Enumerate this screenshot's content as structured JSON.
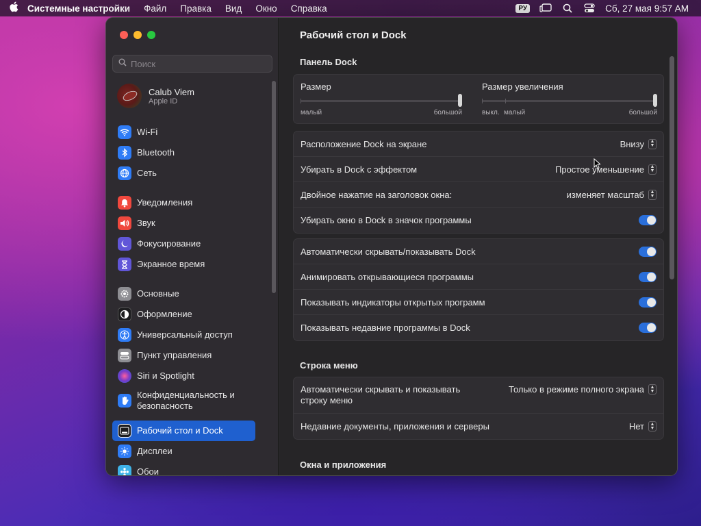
{
  "menubar": {
    "app_name": "Системные настройки",
    "menus": [
      "Файл",
      "Правка",
      "Вид",
      "Окно",
      "Справка"
    ],
    "input_source": "РУ",
    "datetime": "Сб, 27 мая  9:57 AM"
  },
  "sidebar": {
    "search_placeholder": "Поиск",
    "account": {
      "name": "Calub Viem",
      "sub": "Apple ID"
    },
    "items": [
      {
        "label": "Wi-Fi",
        "icon": "wifi-icon",
        "color": "#2f7cf6"
      },
      {
        "label": "Bluetooth",
        "icon": "bluetooth-icon",
        "color": "#2f7cf6"
      },
      {
        "label": "Сеть",
        "icon": "globe-icon",
        "color": "#2f7cf6"
      },
      {
        "label": "Уведомления",
        "icon": "bell-icon",
        "color": "#f0483e"
      },
      {
        "label": "Звук",
        "icon": "speaker-icon",
        "color": "#f0483e"
      },
      {
        "label": "Фокусирование",
        "icon": "moon-icon",
        "color": "#6156d8"
      },
      {
        "label": "Экранное время",
        "icon": "hourglass-icon",
        "color": "#6156d8"
      },
      {
        "label": "Основные",
        "icon": "gear-icon",
        "color": "#8e8e93"
      },
      {
        "label": "Оформление",
        "icon": "appearance-icon",
        "color": "#1c1c1e"
      },
      {
        "label": "Универсальный доступ",
        "icon": "accessibility-icon",
        "color": "#2f7cf6"
      },
      {
        "label": "Пункт управления",
        "icon": "control-center-icon",
        "color": "#8e8e93"
      },
      {
        "label": "Siri и Spotlight",
        "icon": "siri-icon",
        "color": "#7a3cc8"
      },
      {
        "label": "Конфиденциальность и безопасность",
        "icon": "hand-icon",
        "color": "#2f7cf6"
      },
      {
        "label": "Рабочий стол и Dock",
        "icon": "dock-icon",
        "color": "#1c1c1e"
      },
      {
        "label": "Дисплеи",
        "icon": "display-icon",
        "color": "#2f7cf6"
      },
      {
        "label": "Обои",
        "icon": "wallpaper-icon",
        "color": "#3fb3e8"
      }
    ]
  },
  "content": {
    "title": "Рабочий стол и Dock",
    "dock_section": "Панель Dock",
    "size": {
      "label": "Размер",
      "min": "малый",
      "max": "большой",
      "value": 1.0
    },
    "magnification": {
      "label": "Размер увеличения",
      "off": "выкл.",
      "min": "малый",
      "max": "большой",
      "value": 1.0
    },
    "position_row": {
      "label": "Расположение Dock на экране",
      "value": "Внизу"
    },
    "minimize_row": {
      "label": "Убирать в Dock с эффектом",
      "value": "Простое уменьшение"
    },
    "double_click_row": {
      "label": "Двойное нажатие на заголовок окна:",
      "value": "изменяет масштаб"
    },
    "minimize_to_app": {
      "label": "Убирать окно в Dock в значок программы",
      "on": true
    },
    "toggles": [
      {
        "label": "Автоматически скрывать/показывать Dock",
        "on": true
      },
      {
        "label": "Анимировать открывающиеся программы",
        "on": true
      },
      {
        "label": "Показывать индикаторы открытых программ",
        "on": true
      },
      {
        "label": "Показывать недавние программы в Dock",
        "on": true
      }
    ],
    "menubar_section": "Строка меню",
    "autohide_menu": {
      "label_line1": "Автоматически скрывать и показывать",
      "label_line2": "строку меню",
      "value": "Только в режиме полного экрана"
    },
    "recent_docs": {
      "label": "Недавние документы, приложения и серверы",
      "value": "Нет"
    },
    "windows_section": "Окна и приложения"
  }
}
